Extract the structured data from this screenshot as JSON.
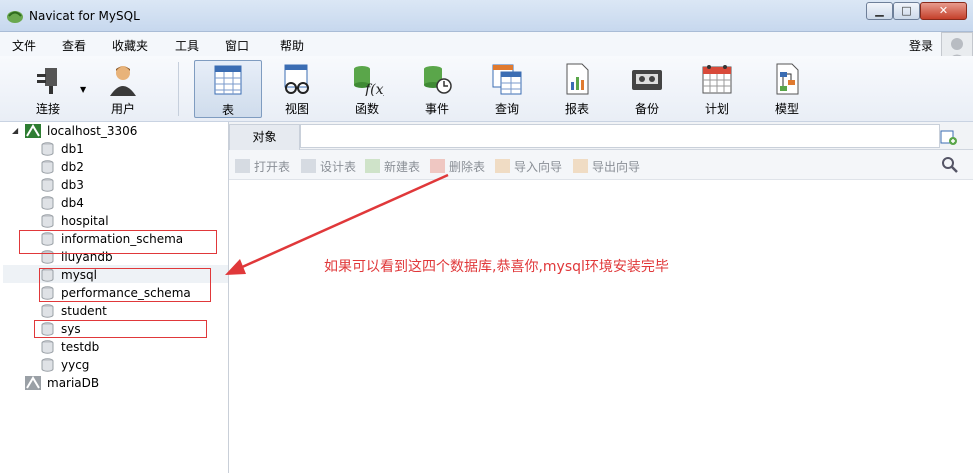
{
  "window": {
    "title": "Navicat for MySQL"
  },
  "menu": {
    "items": [
      "文件",
      "查看",
      "收藏夹",
      "工具",
      "窗口",
      "帮助"
    ],
    "login": "登录"
  },
  "toolbar": {
    "items": [
      {
        "label": "连接",
        "icon": "plug-icon"
      },
      {
        "label": "用户",
        "icon": "user-icon"
      },
      {
        "label": "表",
        "icon": "table-icon"
      },
      {
        "label": "视图",
        "icon": "view-icon"
      },
      {
        "label": "函数",
        "icon": "function-icon"
      },
      {
        "label": "事件",
        "icon": "event-icon"
      },
      {
        "label": "查询",
        "icon": "query-icon"
      },
      {
        "label": "报表",
        "icon": "report-icon"
      },
      {
        "label": "备份",
        "icon": "backup-icon"
      },
      {
        "label": "计划",
        "icon": "schedule-icon"
      },
      {
        "label": "模型",
        "icon": "model-icon"
      }
    ]
  },
  "tree": {
    "connection": "localhost_3306",
    "databases": [
      "db1",
      "db2",
      "db3",
      "db4",
      "hospital",
      "information_schema",
      "liuyandb",
      "mysql",
      "performance_schema",
      "student",
      "sys",
      "testdb",
      "yycg"
    ],
    "connection2": "mariaDB"
  },
  "tabs": {
    "object": "对象"
  },
  "object_toolbar": {
    "open": "打开表",
    "design": "设计表",
    "new": "新建表",
    "delete": "删除表",
    "import": "导入向导",
    "export": "导出向导"
  },
  "annotation": "如果可以看到这四个数据库,恭喜你,mysql环境安装完毕",
  "colors": {
    "annotation": "#e0383a",
    "accent": "#7f9cc0"
  }
}
